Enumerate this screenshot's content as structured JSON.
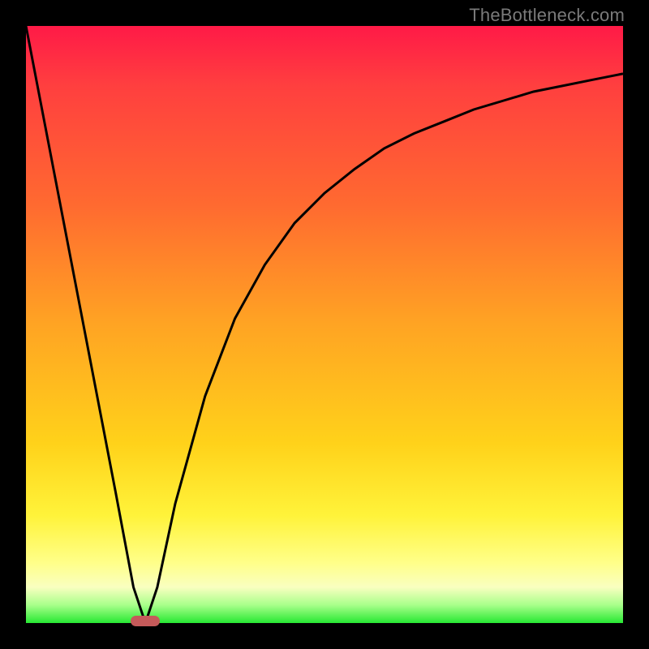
{
  "attribution": "TheBottleneck.com",
  "colors": {
    "frame": "#000000",
    "gradient_top": "#ff1a47",
    "gradient_mid": "#ffd21a",
    "gradient_bottom": "#27e833",
    "curve": "#000000",
    "marker": "#c55a5a",
    "attribution_text": "#7a7a7a"
  },
  "chart_data": {
    "type": "line",
    "title": "",
    "xlabel": "",
    "ylabel": "",
    "xlim": [
      0,
      100
    ],
    "ylim": [
      0,
      100
    ],
    "grid": false,
    "series": [
      {
        "name": "bottleneck-curve",
        "x": [
          0,
          5,
          10,
          15,
          18,
          20,
          22,
          25,
          30,
          35,
          40,
          45,
          50,
          55,
          60,
          65,
          70,
          75,
          80,
          85,
          90,
          95,
          100
        ],
        "values": [
          100,
          74,
          48,
          22,
          6,
          0,
          6,
          20,
          38,
          51,
          60,
          67,
          72,
          76,
          79.5,
          82,
          84,
          86,
          87.5,
          89,
          90,
          91,
          92
        ]
      }
    ],
    "optimum_x": 20,
    "annotations": [
      {
        "name": "optimum-marker",
        "x": 20,
        "y": 0
      }
    ]
  }
}
